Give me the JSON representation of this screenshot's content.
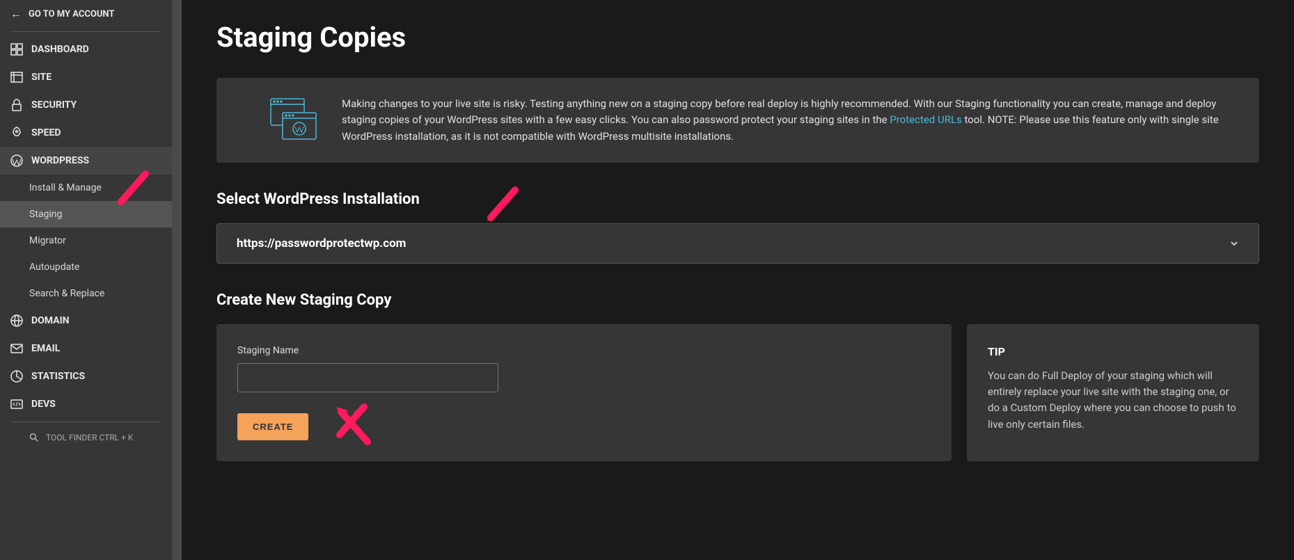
{
  "header": {
    "account_link": "GO TO MY ACCOUNT"
  },
  "sidebar": {
    "items": [
      {
        "label": "DASHBOARD"
      },
      {
        "label": "SITE"
      },
      {
        "label": "SECURITY"
      },
      {
        "label": "SPEED"
      },
      {
        "label": "WORDPRESS"
      },
      {
        "label": "DOMAIN"
      },
      {
        "label": "EMAIL"
      },
      {
        "label": "STATISTICS"
      },
      {
        "label": "DEVS"
      }
    ],
    "wordpress_sub": [
      {
        "label": "Install & Manage"
      },
      {
        "label": "Staging"
      },
      {
        "label": "Migrator"
      },
      {
        "label": "Autoupdate"
      },
      {
        "label": "Search & Replace"
      }
    ],
    "tool_finder": "TOOL FINDER CTRL + K"
  },
  "page": {
    "title": "Staging Copies",
    "info_text_1": "Making changes to your live site is risky. Testing anything new on a staging copy before real deploy is highly recommended. With our Staging functionality you can create, manage and deploy staging copies of your WordPress sites with a few easy clicks. You can also password protect your staging sites in the ",
    "info_link": "Protected URLs",
    "info_text_2": " tool. NOTE: Please use this feature only with single site WordPress installation, as it is not compatible with WordPress multisite installations.",
    "select_title": "Select WordPress Installation",
    "selected_site": "https://passwordprotectwp.com",
    "create_title": "Create New Staging Copy",
    "staging_label": "Staging Name",
    "staging_value": "",
    "create_button": "CREATE",
    "tip_title": "TIP",
    "tip_text": "You can do Full Deploy of your staging which will entirely replace your live site with the staging one, or do a Custom Deploy where you can choose to push to live only certain files."
  }
}
